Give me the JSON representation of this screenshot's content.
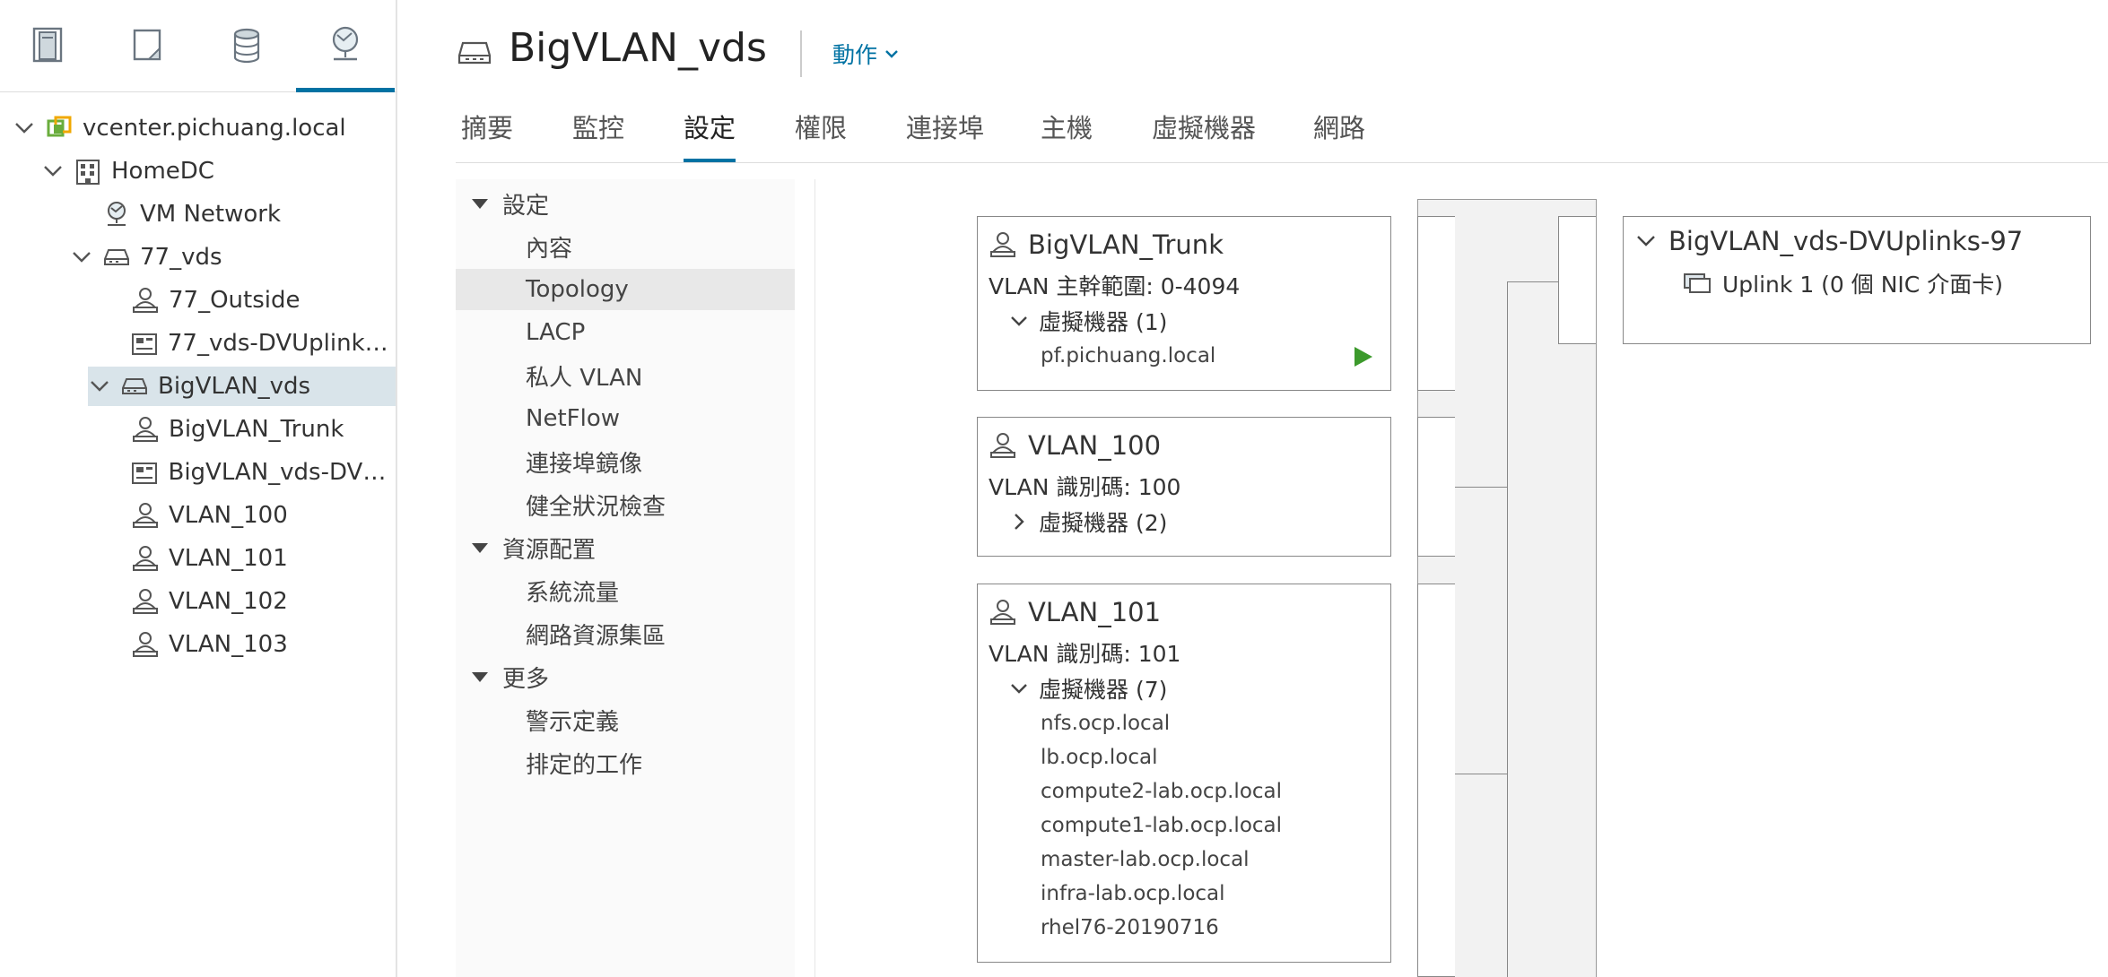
{
  "nav": {
    "tabs": [
      {
        "icon": "hosts-clusters-icon",
        "active": false
      },
      {
        "icon": "vms-templates-icon",
        "active": false
      },
      {
        "icon": "storage-icon",
        "active": false
      },
      {
        "icon": "networking-icon",
        "active": true
      }
    ],
    "tree": [
      {
        "label": "vcenter.pichuang.local",
        "icon": "vcenter-icon",
        "expanded": true
      },
      {
        "label": "HomeDC",
        "icon": "datacenter-icon",
        "expanded": true
      },
      {
        "label": "VM Network",
        "icon": "network-icon"
      },
      {
        "label": "77_vds",
        "icon": "distributed-switch-icon",
        "expanded": true
      },
      {
        "label": "77_Outside",
        "icon": "portgroup-icon"
      },
      {
        "label": "77_vds-DVUplinks-...",
        "icon": "uplink-portgroup-icon"
      },
      {
        "label": "BigVLAN_vds",
        "icon": "distributed-switch-icon",
        "expanded": true,
        "selected": true
      },
      {
        "label": "BigVLAN_Trunk",
        "icon": "portgroup-icon"
      },
      {
        "label": "BigVLAN_vds-DVU...",
        "icon": "uplink-portgroup-icon"
      },
      {
        "label": "VLAN_100",
        "icon": "portgroup-icon"
      },
      {
        "label": "VLAN_101",
        "icon": "portgroup-icon"
      },
      {
        "label": "VLAN_102",
        "icon": "portgroup-icon"
      },
      {
        "label": "VLAN_103",
        "icon": "portgroup-icon"
      }
    ]
  },
  "header": {
    "title": "BigVLAN_vds",
    "actions_label": "動作"
  },
  "tabs": [
    "摘要",
    "監控",
    "設定",
    "權限",
    "連接埠",
    "主機",
    "虛擬機器",
    "網路"
  ],
  "active_tab": "設定",
  "settings": {
    "groups": [
      {
        "label": "設定",
        "items": [
          "內容",
          "Topology",
          "LACP",
          "私人 VLAN",
          "NetFlow",
          "連接埠鏡像",
          "健全狀況檢查"
        ]
      },
      {
        "label": "資源配置",
        "items": [
          "系統流量",
          "網路資源集區"
        ]
      },
      {
        "label": "更多",
        "items": [
          "警示定義",
          "排定的工作"
        ]
      }
    ],
    "selected_item": "Topology"
  },
  "topology": {
    "portgroups": [
      {
        "name": "BigVLAN_Trunk",
        "vlan_text": "VLAN 主幹範圍: 0-4094",
        "vm_header": "虛擬機器 (1)",
        "expanded": true,
        "vms": [
          "pf.pichuang.local"
        ]
      },
      {
        "name": "VLAN_100",
        "vlan_text": "VLAN 識別碼: 100",
        "vm_header": "虛擬機器 (2)",
        "expanded": false,
        "vms": []
      },
      {
        "name": "VLAN_101",
        "vlan_text": "VLAN 識別碼: 101",
        "vm_header": "虛擬機器 (7)",
        "expanded": true,
        "vms": [
          "nfs.ocp.local",
          "lb.ocp.local",
          "compute2-lab.ocp.local",
          "compute1-lab.ocp.local",
          "master-lab.ocp.local",
          "infra-lab.ocp.local",
          "rhel76-20190716"
        ]
      }
    ],
    "uplink_group": {
      "name": "BigVLAN_vds-DVUplinks-97",
      "uplinks": [
        "Uplink 1 (0 個 NIC 介面卡)"
      ]
    }
  },
  "colors": {
    "accent": "#0072a3",
    "selected_bg": "#d9e4ea",
    "running_green": "#3c9a2c"
  }
}
